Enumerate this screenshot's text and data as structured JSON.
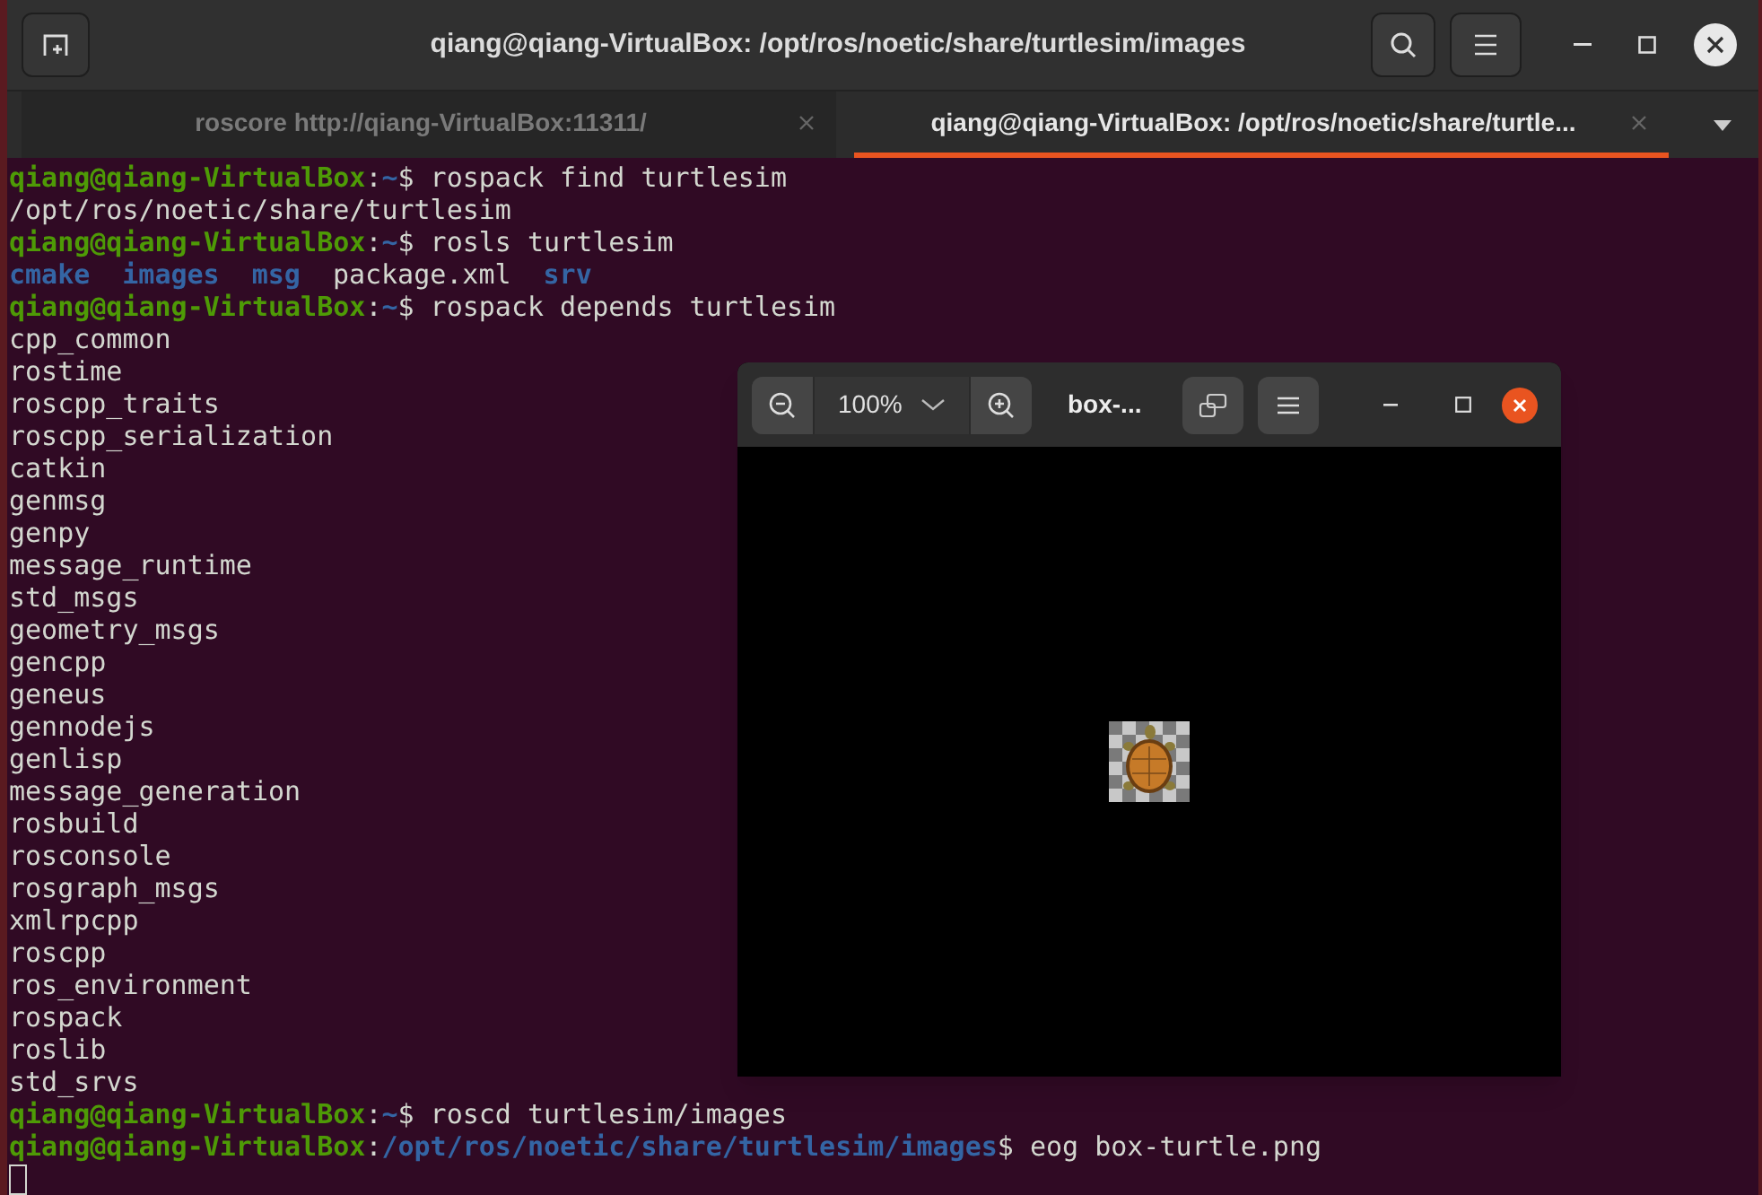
{
  "window": {
    "title": "qiang@qiang-VirtualBox: /opt/ros/noetic/share/turtlesim/images"
  },
  "tabs": [
    {
      "label": "roscore http://qiang-VirtualBox:11311/",
      "selected": false
    },
    {
      "label": "qiang@qiang-VirtualBox: /opt/ros/noetic/share/turtle...",
      "selected": true
    }
  ],
  "terminal": {
    "lines": [
      {
        "kind": "prompt",
        "user": "qiang@qiang-VirtualBox",
        "separator": ":",
        "path": "~",
        "symbol": "$",
        "command": "rospack find turtlesim"
      },
      {
        "kind": "output",
        "text": "/opt/ros/noetic/share/turtlesim"
      },
      {
        "kind": "prompt",
        "user": "qiang@qiang-VirtualBox",
        "separator": ":",
        "path": "~",
        "symbol": "$",
        "command": "rosls turtlesim"
      },
      {
        "kind": "listing",
        "items": [
          {
            "name": "cmake",
            "kind": "dir"
          },
          {
            "name": "images",
            "kind": "dir"
          },
          {
            "name": "msg",
            "kind": "dir"
          },
          {
            "name": "package.xml",
            "kind": "file"
          },
          {
            "name": "srv",
            "kind": "dir"
          }
        ]
      },
      {
        "kind": "prompt",
        "user": "qiang@qiang-VirtualBox",
        "separator": ":",
        "path": "~",
        "symbol": "$",
        "command": "rospack depends turtlesim"
      },
      {
        "kind": "output",
        "text": "cpp_common"
      },
      {
        "kind": "output",
        "text": "rostime"
      },
      {
        "kind": "output",
        "text": "roscpp_traits"
      },
      {
        "kind": "output",
        "text": "roscpp_serialization"
      },
      {
        "kind": "output",
        "text": "catkin"
      },
      {
        "kind": "output",
        "text": "genmsg"
      },
      {
        "kind": "output",
        "text": "genpy"
      },
      {
        "kind": "output",
        "text": "message_runtime"
      },
      {
        "kind": "output",
        "text": "std_msgs"
      },
      {
        "kind": "output",
        "text": "geometry_msgs"
      },
      {
        "kind": "output",
        "text": "gencpp"
      },
      {
        "kind": "output",
        "text": "geneus"
      },
      {
        "kind": "output",
        "text": "gennodejs"
      },
      {
        "kind": "output",
        "text": "genlisp"
      },
      {
        "kind": "output",
        "text": "message_generation"
      },
      {
        "kind": "output",
        "text": "rosbuild"
      },
      {
        "kind": "output",
        "text": "rosconsole"
      },
      {
        "kind": "output",
        "text": "rosgraph_msgs"
      },
      {
        "kind": "output",
        "text": "xmlrpcpp"
      },
      {
        "kind": "output",
        "text": "roscpp"
      },
      {
        "kind": "output",
        "text": "ros_environment"
      },
      {
        "kind": "output",
        "text": "rospack"
      },
      {
        "kind": "output",
        "text": "roslib"
      },
      {
        "kind": "output",
        "text": "std_srvs"
      },
      {
        "kind": "prompt",
        "user": "qiang@qiang-VirtualBox",
        "separator": ":",
        "path": "~",
        "symbol": "$",
        "command": "roscd turtlesim/images"
      },
      {
        "kind": "prompt",
        "user": "qiang@qiang-VirtualBox",
        "separator": ":",
        "path": "/opt/ros/noetic/share/turtlesim/images",
        "symbol": "$",
        "command": "eog box-turtle.png"
      },
      {
        "kind": "cursor"
      }
    ]
  },
  "image_viewer": {
    "zoom": "100%",
    "title": "box-..."
  }
}
